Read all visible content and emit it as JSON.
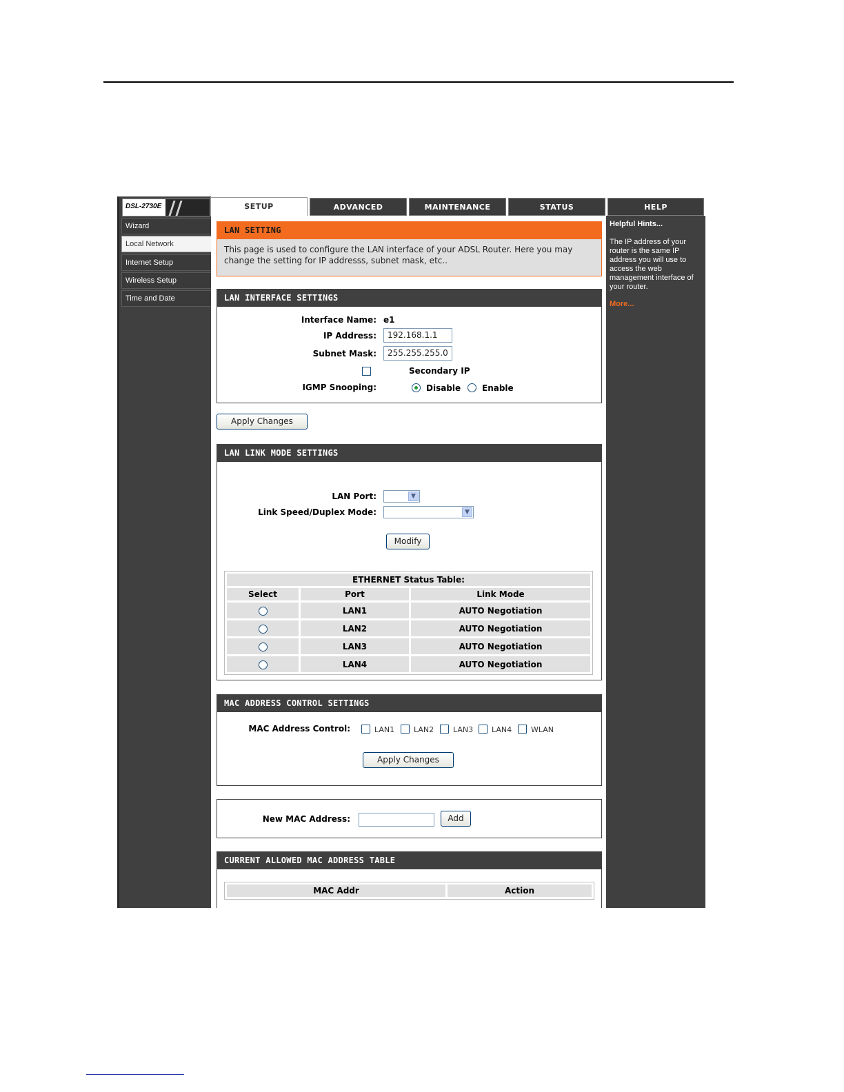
{
  "logo": {
    "model": "DSL-2730E"
  },
  "sidebar": {
    "items": [
      {
        "label": "Wizard"
      },
      {
        "label": "Local Network"
      },
      {
        "label": "Internet Setup"
      },
      {
        "label": "Wireless Setup"
      },
      {
        "label": "Time and Date"
      }
    ]
  },
  "tabs": [
    {
      "label": "SETUP"
    },
    {
      "label": "ADVANCED"
    },
    {
      "label": "MAINTENANCE"
    },
    {
      "label": "STATUS"
    },
    {
      "label": "HELP"
    }
  ],
  "lan_setting": {
    "title": "LAN SETTING",
    "description": "This page is used to configure the LAN interface of your ADSL Router. Here you may change the setting for IP addresss, subnet mask, etc.."
  },
  "lan_interface": {
    "title": "LAN INTERFACE SETTINGS",
    "interface_name_label": "Interface Name:",
    "interface_name_value": "e1",
    "ip_label": "IP Address:",
    "ip_value": "192.168.1.1",
    "mask_label": "Subnet Mask:",
    "mask_value": "255.255.255.0",
    "secondary_ip_label": "Secondary IP",
    "igmp_label": "IGMP Snooping:",
    "igmp_disable": "Disable",
    "igmp_enable": "Enable",
    "igmp_selected": "Disable"
  },
  "apply_changes_1": "Apply Changes",
  "lan_link": {
    "title": "LAN LINK MODE SETTINGS",
    "port_label": "LAN Port:",
    "speed_label": "Link Speed/Duplex Mode:",
    "modify_label": "Modify",
    "table_title": "ETHERNET Status Table:",
    "columns": [
      "Select",
      "Port",
      "Link Mode"
    ],
    "rows": [
      {
        "port": "LAN1",
        "mode": "AUTO Negotiation"
      },
      {
        "port": "LAN2",
        "mode": "AUTO Negotiation"
      },
      {
        "port": "LAN3",
        "mode": "AUTO Negotiation"
      },
      {
        "port": "LAN4",
        "mode": "AUTO Negotiation"
      }
    ]
  },
  "mac_control": {
    "title": "MAC ADDRESS CONTROL SETTINGS",
    "label": "MAC Address Control:",
    "options": [
      "LAN1",
      "LAN2",
      "LAN3",
      "LAN4",
      "WLAN"
    ],
    "apply_label": "Apply Changes"
  },
  "new_mac": {
    "label": "New MAC Address:",
    "value": "",
    "add_label": "Add"
  },
  "allowed_mac": {
    "title": "CURRENT ALLOWED MAC ADDRESS TABLE",
    "columns": [
      "MAC Addr",
      "Action"
    ]
  },
  "help": {
    "title": "Helpful Hints...",
    "text": "The IP address of your router is the same IP address you will use to access the web management interface of your router.",
    "more": "More..."
  },
  "colors": {
    "accent": "#f26b1f",
    "dark": "#404040",
    "radio_selected": "#2b9a3f"
  }
}
